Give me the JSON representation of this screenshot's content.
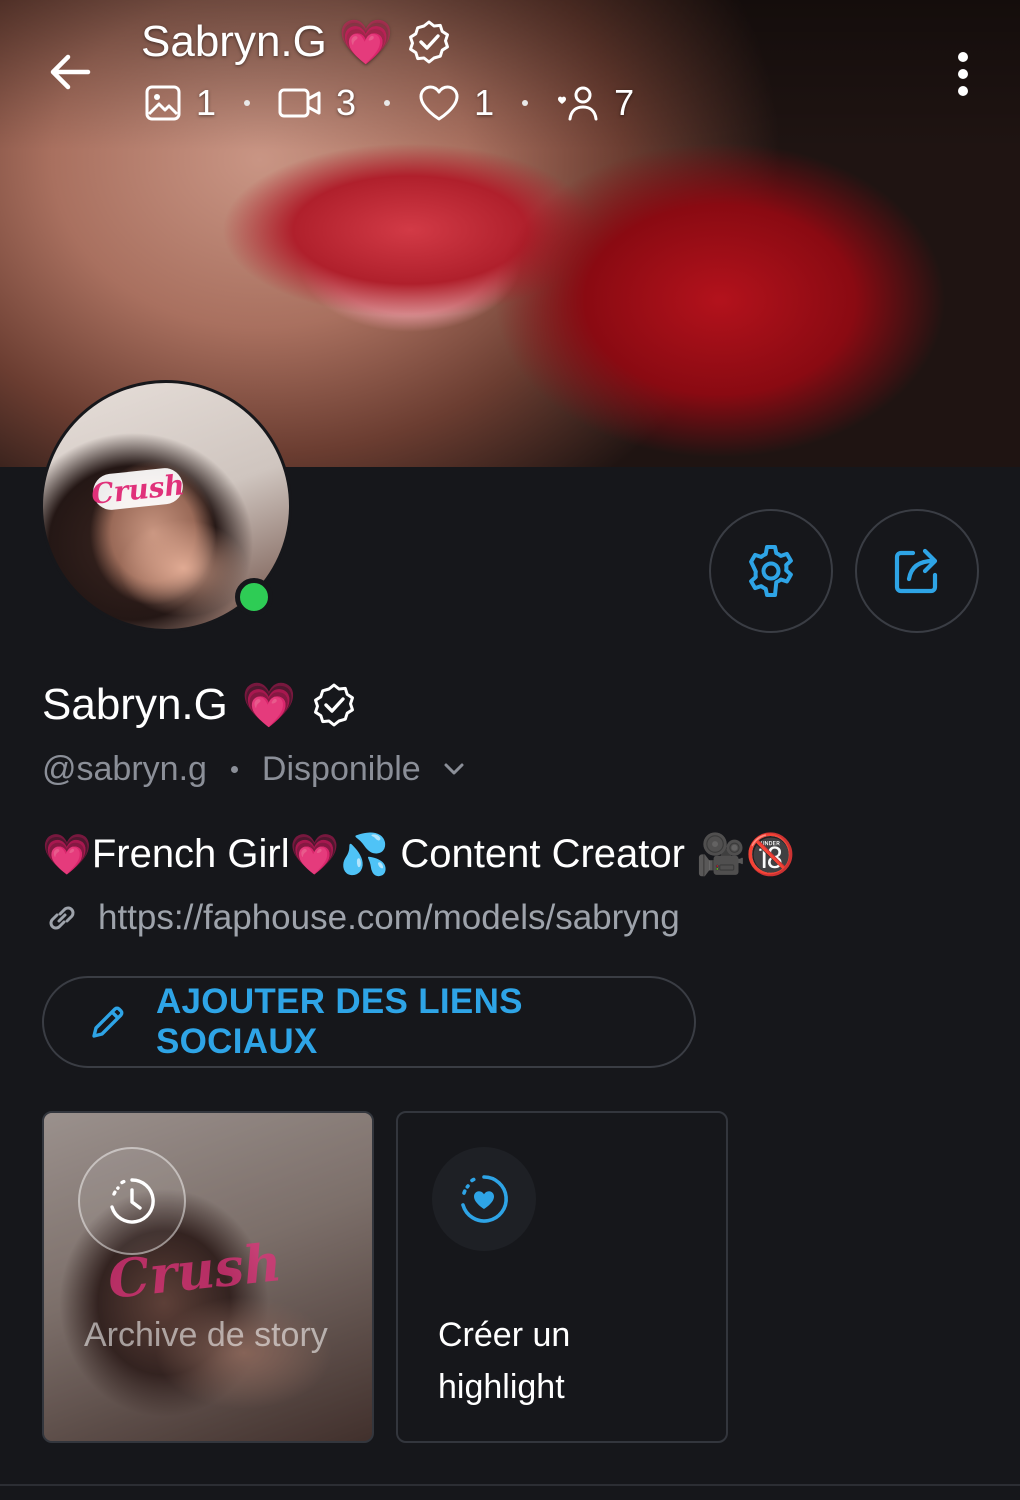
{
  "header": {
    "title": "Sabryn.G",
    "title_emoji": "💗",
    "stats": [
      {
        "icon": "image-icon",
        "value": "1"
      },
      {
        "icon": "video-icon",
        "value": "3"
      },
      {
        "icon": "heart-icon",
        "value": "1"
      },
      {
        "icon": "fans-icon",
        "value": "7"
      }
    ]
  },
  "profile": {
    "name": "Sabryn.G",
    "name_emoji": "💗",
    "handle": "@sabryn.g",
    "status": "Disponible",
    "bio": {
      "p1": "💗",
      "p2": "French Girl",
      "p3": "💗",
      "p4": "💦",
      "p5": " Content Creator ",
      "p6": "🎥",
      "p7": "🔞"
    },
    "link": "https://faphouse.com/models/sabryng",
    "avatar_watermark": "Crush"
  },
  "actions": {
    "social_button": "AJOUTER DES LIENS SOCIAUX"
  },
  "cards": {
    "archive_label": "Archive de story",
    "create_label": "Créer un highlight",
    "archive_watermark": "Crush"
  },
  "colors": {
    "accent": "#2ea4e6",
    "background": "#16171b",
    "online": "#2ecc55",
    "muted": "#8b8f98"
  }
}
